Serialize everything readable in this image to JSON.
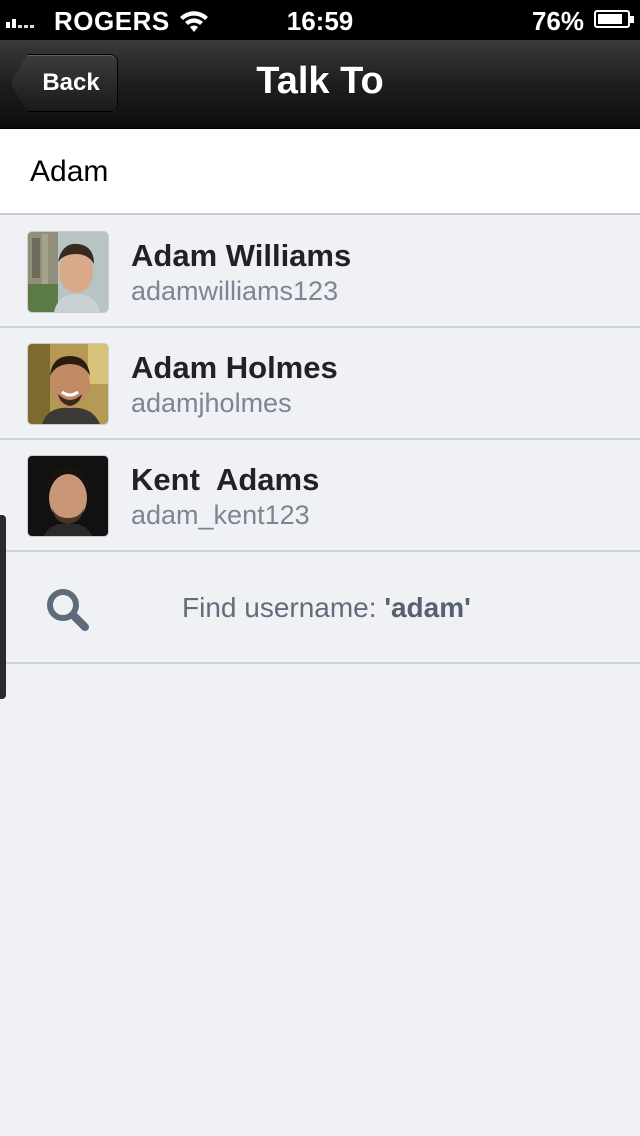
{
  "status_bar": {
    "carrier": "ROGERS",
    "time": "16:59",
    "battery": "76%"
  },
  "nav": {
    "back_label": "Back",
    "title": "Talk To"
  },
  "search": {
    "value": "Adam"
  },
  "contacts": [
    {
      "name": "Adam Williams",
      "username": "adamwilliams123"
    },
    {
      "name": "Adam Holmes",
      "username": "adamjholmes"
    },
    {
      "name": "Kent  Adams",
      "username": "adam_kent123"
    }
  ],
  "find": {
    "prefix": "Find username: ",
    "query": "'adam'"
  },
  "colors": {
    "background": "#eff1f5",
    "secondary_text": "#7b8594",
    "icon": "#5f6a7b"
  }
}
